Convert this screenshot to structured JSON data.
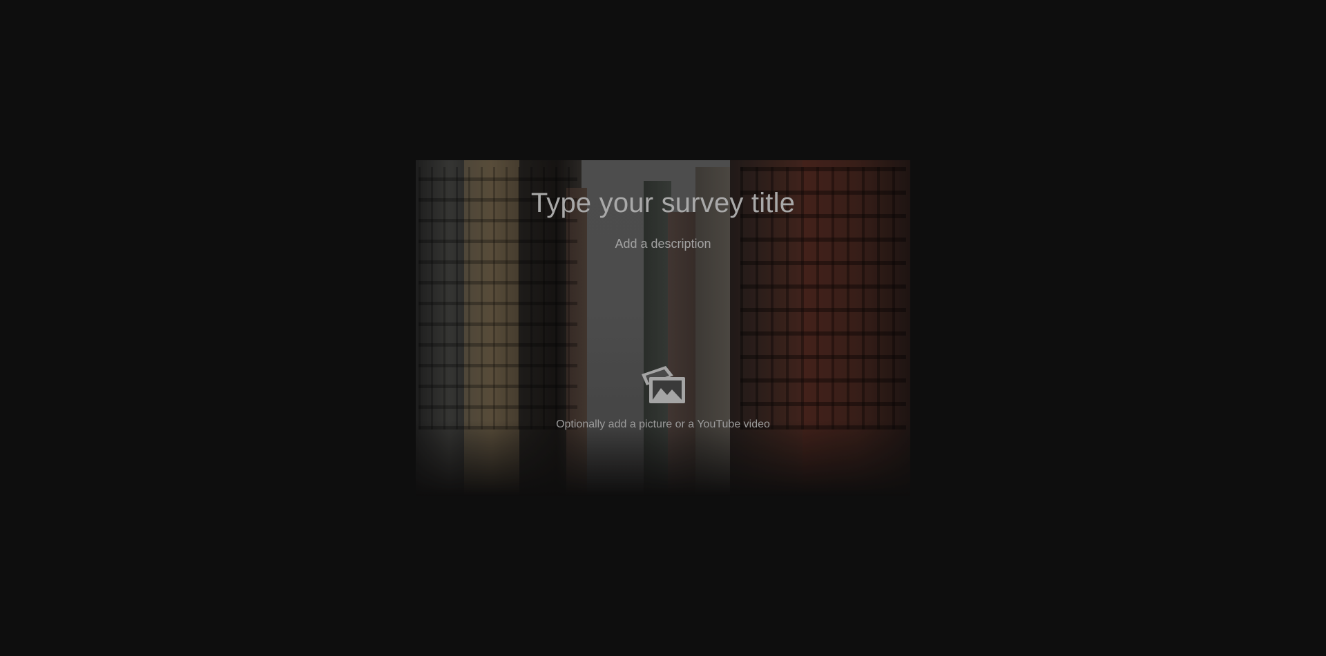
{
  "survey": {
    "title_placeholder": "Type your survey title",
    "description_placeholder": "Add a description",
    "media_prompt": "Optionally add a picture or a YouTube video",
    "media_icon": "image-upload-icon"
  },
  "colors": {
    "page_background": "#0e0e0e",
    "title_text": "#a9a9a9",
    "description_text": "#a2a2a2",
    "icon": "#a5a5a5"
  }
}
